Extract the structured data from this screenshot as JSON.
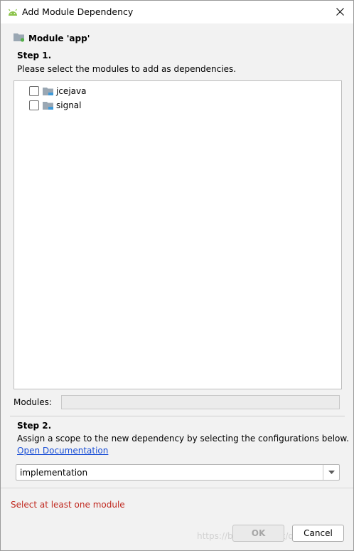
{
  "window": {
    "title": "Add Module Dependency"
  },
  "header": {
    "module_label": "Module 'app'"
  },
  "step1": {
    "title": "Step 1.",
    "description": "Please select the modules to add as dependencies.",
    "modules": [
      {
        "label": "jcejava",
        "checked": false
      },
      {
        "label": "signal",
        "checked": false
      }
    ]
  },
  "modules_field": {
    "label": "Modules:",
    "value": ""
  },
  "step2": {
    "title": "Step 2.",
    "description": "Assign a scope to the new dependency by selecting the configurations below.",
    "link": "Open Documentation",
    "scope_selected": "implementation"
  },
  "error": "Select at least one module",
  "buttons": {
    "ok": "OK",
    "cancel": "Cancel"
  },
  "watermark": "https://blog.csdn.net/qq_...",
  "colors": {
    "error": "#c0281f",
    "link": "#1a4fd6",
    "android": "#8bc34a"
  },
  "icons": {
    "title": "android-icon",
    "close": "close-icon",
    "module": "module-folder-icon"
  }
}
